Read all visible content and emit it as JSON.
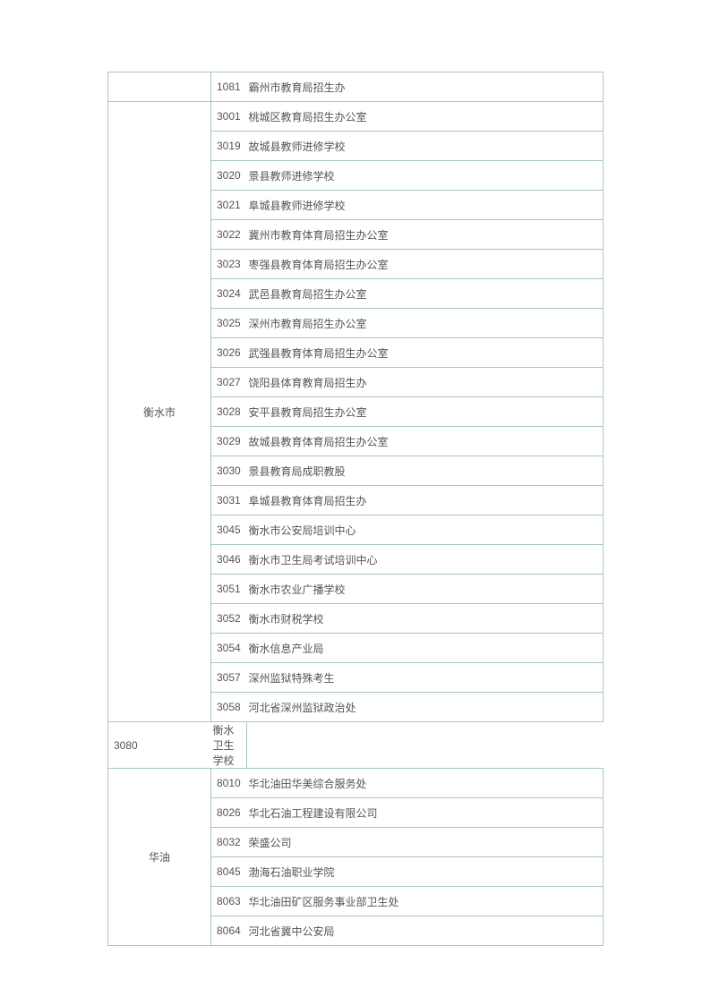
{
  "rows": [
    {
      "region": "",
      "rowspan": 1,
      "code": "1081",
      "name": "霸州市教育局招生办"
    },
    {
      "region": "衡水市",
      "rowspan": 21,
      "code": "3001",
      "name": "桃城区教育局招生办公室"
    },
    {
      "code": "3019",
      "name": "故城县教师进修学校"
    },
    {
      "code": "3020",
      "name": "景县教师进修学校"
    },
    {
      "code": "3021",
      "name": "阜城县教师进修学校"
    },
    {
      "code": "3022",
      "name": "冀州市教育体育局招生办公室"
    },
    {
      "code": "3023",
      "name": "枣强县教育体育局招生办公室"
    },
    {
      "code": "3024",
      "name": "武邑县教育局招生办公室"
    },
    {
      "code": "3025",
      "name": "深州市教育局招生办公室"
    },
    {
      "code": "3026",
      "name": "武强县教育体育局招生办公室"
    },
    {
      "code": "3027",
      "name": "饶阳县体育教育局招生办"
    },
    {
      "code": "3028",
      "name": "安平县教育局招生办公室"
    },
    {
      "code": "3029",
      "name": "故城县教育体育局招生办公室"
    },
    {
      "code": "3030",
      "name": "景县教育局成职教股"
    },
    {
      "code": "3031",
      "name": "阜城县教育体育局招生办"
    },
    {
      "code": "3045",
      "name": "衡水市公安局培训中心"
    },
    {
      "code": "3046",
      "name": "衡水市卫生局考试培训中心"
    },
    {
      "code": "3051",
      "name": "衡水市农业广播学校"
    },
    {
      "code": "3052",
      "name": "衡水市财税学校"
    },
    {
      "code": "3054",
      "name": "衡水信息产业局"
    },
    {
      "code": "3057",
      "name": "深州监狱特殊考生"
    },
    {
      "code": "3058",
      "name": "河北省深州监狱政治处"
    },
    {
      "code": "3080",
      "name": "衡水卫生学校"
    },
    {
      "region": "华油",
      "rowspan": 6,
      "code": "8010",
      "name": "华北油田华美综合服务处"
    },
    {
      "code": "8026",
      "name": "华北石油工程建设有限公司"
    },
    {
      "code": "8032",
      "name": "荣盛公司"
    },
    {
      "code": "8045",
      "name": "渤海石油职业学院"
    },
    {
      "code": "8063",
      "name": "华北油田矿区服务事业部卫生处"
    },
    {
      "code": "8064",
      "name": "河北省冀中公安局"
    }
  ]
}
